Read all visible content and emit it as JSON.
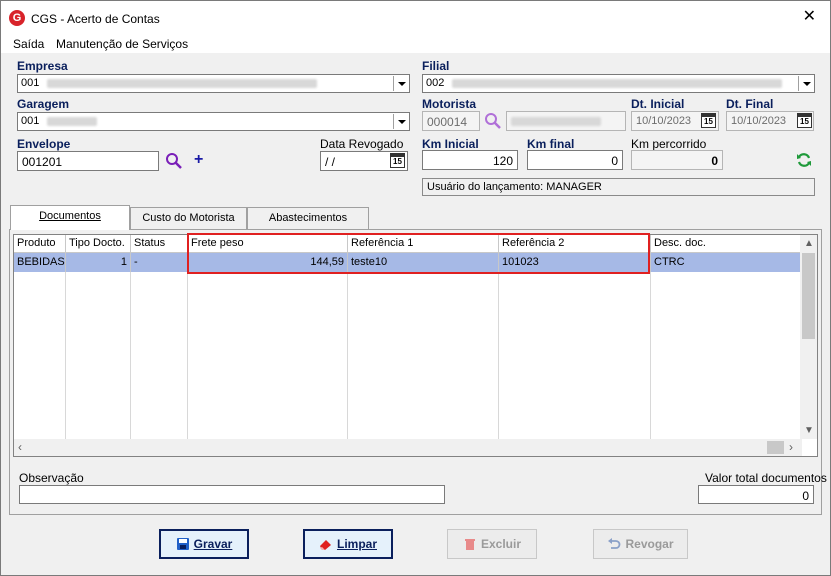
{
  "window": {
    "title": "CGS - Acerto de Contas",
    "app_icon": "app-logo-icon",
    "close_glyph": "✕"
  },
  "menu": {
    "items": [
      "Saída",
      "Manutenção de Serviços"
    ]
  },
  "form": {
    "empresa": {
      "label": "Empresa",
      "value": "001"
    },
    "filial": {
      "label": "Filial",
      "value": "002"
    },
    "garagem": {
      "label": "Garagem",
      "value": "001"
    },
    "motorista": {
      "label": "Motorista",
      "code": "000014",
      "name": ""
    },
    "dt_inicial": {
      "label": "Dt. Inicial",
      "value": "10/10/2023"
    },
    "dt_final": {
      "label": "Dt. Final",
      "value": "10/10/2023"
    },
    "envelope": {
      "label": "Envelope",
      "value": "001201"
    },
    "data_revogado": {
      "label": "Data Revogado",
      "value": " /  /"
    },
    "km_inicial": {
      "label": "Km Inicial",
      "value": "120"
    },
    "km_final": {
      "label": "Km final",
      "value": "0"
    },
    "km_percorrido": {
      "label": "Km percorrido",
      "value": "0"
    },
    "usuario": "Usuário do lançamento: MANAGER",
    "calendar_glyph": "15"
  },
  "tabs": [
    {
      "label": "Documentos",
      "active": true
    },
    {
      "label": "Custo do Motorista",
      "active": false
    },
    {
      "label": "Abastecimentos",
      "active": false
    }
  ],
  "grid": {
    "columns": [
      "Produto",
      "Tipo Docto.",
      "Status",
      "Frete peso",
      "Referência 1",
      "Referência 2",
      "Desc. doc."
    ],
    "rows": [
      {
        "produto": "BEBIDAS",
        "tipo": "1",
        "status": "-",
        "frete": "144,59",
        "ref1": "teste10",
        "ref2": "101023",
        "desc": "CTRC"
      }
    ]
  },
  "observacao": {
    "label": "Observação",
    "value": ""
  },
  "valor_total": {
    "label": "Valor total documentos",
    "value": "0"
  },
  "buttons": {
    "gravar": "Gravar",
    "limpar": "Limpar",
    "excluir": "Excluir",
    "revogar": "Revogar"
  },
  "colors": {
    "accent": "#0a1f5c",
    "selection": "#a6b9e6",
    "highlight": "#e02020",
    "brand": "#d8232a"
  }
}
